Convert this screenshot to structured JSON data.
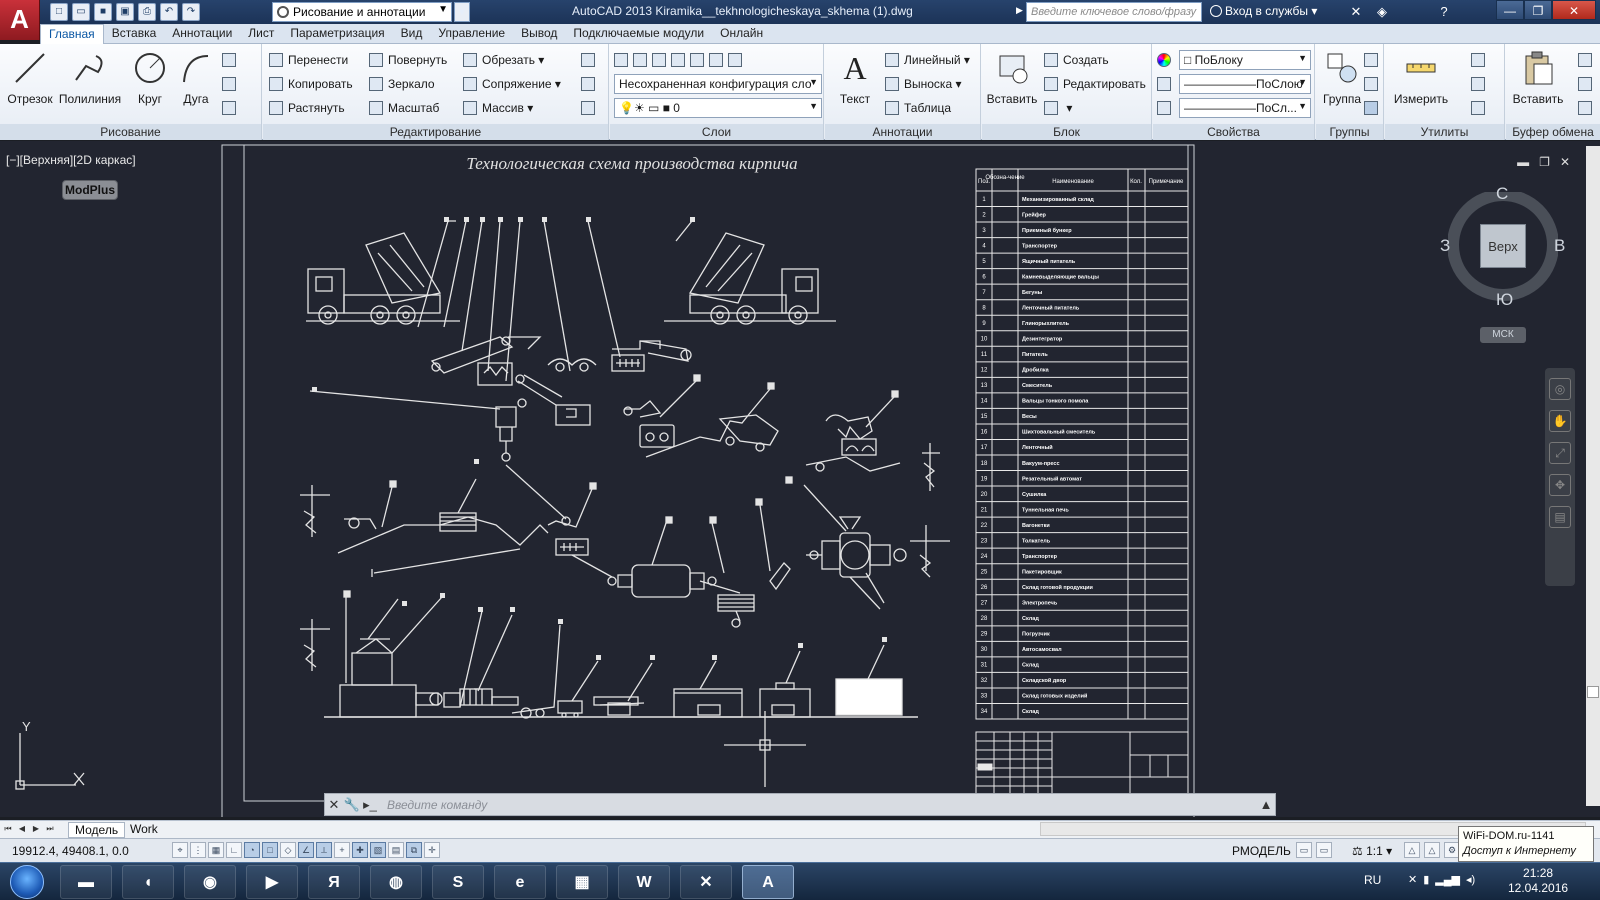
{
  "titlebar": {
    "app_title": "AutoCAD 2013    Kiramika__tekhnologicheskaya_skhema (1).dwg",
    "workspace": "Рисование и аннотации",
    "search_placeholder": "Введите ключевое слово/фразу",
    "signin_label": "Вход в службы",
    "logo": "A"
  },
  "tabs": [
    "Главная",
    "Вставка",
    "Аннотации",
    "Лист",
    "Параметризация",
    "Вид",
    "Управление",
    "Вывод",
    "Подключаемые модули",
    "Онлайн"
  ],
  "ribbon": {
    "draw": {
      "title": "Рисование",
      "line": "Отрезок",
      "polyline": "Полилиния",
      "circle": "Круг",
      "arc": "Дуга"
    },
    "modify": {
      "title": "Редактирование",
      "move": "Перенести",
      "rotate": "Повернуть",
      "trim": "Обрезать",
      "copy": "Копировать",
      "mirror": "Зеркало",
      "fillet": "Сопряжение",
      "stretch": "Растянуть",
      "scale": "Масштаб",
      "array": "Массив"
    },
    "layers": {
      "title": "Слои",
      "config": "Несохраненная конфигурация сло",
      "current_layer": "0"
    },
    "annotation": {
      "title": "Аннотации",
      "text": "Текст",
      "linear": "Линейный",
      "leader": "Выноска",
      "table": "Таблица"
    },
    "block": {
      "title": "Блок",
      "insert": "Вставить",
      "create": "Создать",
      "edit": "Редактировать"
    },
    "properties": {
      "title": "Свойства",
      "color": "ПоБлоку",
      "linetype": "ПоСлою",
      "lineweight": "ПоСл..."
    },
    "groups": {
      "title": "Группы",
      "group": "Группа"
    },
    "utilities": {
      "title": "Утилиты",
      "measure": "Измерить"
    },
    "clipboard": {
      "title": "Буфер обмена",
      "paste": "Вставить"
    }
  },
  "drawing": {
    "viewport_label": "[−][Верхняя][2D каркас]",
    "modplus": "ModPlus",
    "sheet_title": "Технологическая схема производства кирпича",
    "spec_headers": [
      "Поз.",
      "Обозна-чение",
      "Наименование",
      "Кол.",
      "Примечание"
    ],
    "spec_rows": [
      "Механизированный склад",
      "Грейфер",
      "Приемный бункер",
      "Транспортер",
      "Ящичный питатель",
      "Камневыделяющие вальцы",
      "Бегуны",
      "Ленточный питатель",
      "Глинорыхлитель",
      "Дезинтегратор",
      "Питатель",
      "Дробилка",
      "Смеситель",
      "Вальцы тонкого помола",
      "Весы",
      "Шихтовальный смеситель",
      "Ленточный",
      "Вакуум-пресс",
      "Резательный автомат",
      "Сушилка",
      "Туннельная печь",
      "Вагонетки",
      "Толкатель",
      "Транспортер",
      "Пакетировщик",
      "Склад готовой продукции",
      "Электропечь",
      "Склад",
      "Погрузчик",
      "Автосамосвал",
      "Склад",
      "Складской двор",
      "Склад готовых изделий",
      "Склад"
    ],
    "viewcube": {
      "n": "С",
      "s": "Ю",
      "w": "З",
      "e": "В",
      "face": "Верх",
      "ucs": "МСК"
    },
    "ucs_y": "Y",
    "ucs_x": "X"
  },
  "cmdline": {
    "placeholder": "Введите команду"
  },
  "layout_tabs": [
    "Модель",
    "Work"
  ],
  "statusbar": {
    "coords": "19912.4, 49408.1, 0.0",
    "model": "РМОДЕЛЬ",
    "scale": "1:1"
  },
  "taskbar": {
    "lang": "RU",
    "time": "21:28",
    "date": "12.04.2016"
  },
  "tooltip": {
    "line1": "WiFi-DOM.ru-1141",
    "line2": "Доступ к Интернету"
  }
}
